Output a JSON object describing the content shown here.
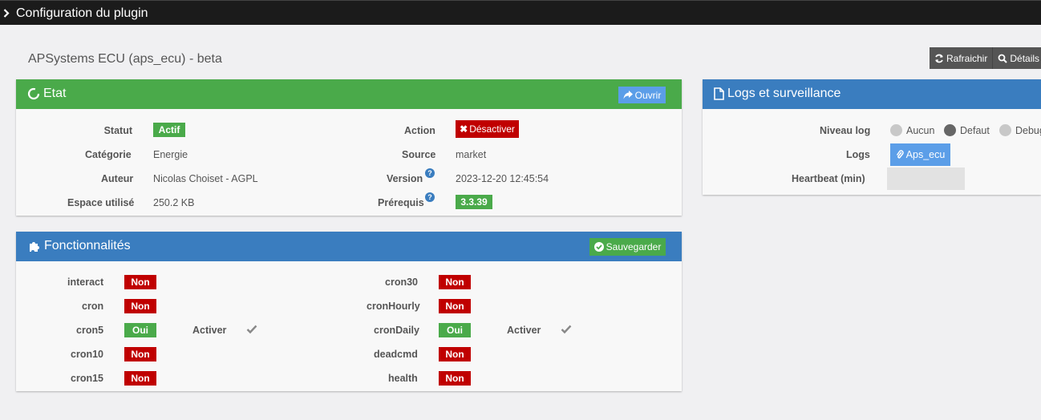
{
  "topbar": {
    "title": "Configuration du plugin"
  },
  "plugin": {
    "title": "APSystems ECU (aps_ecu) - beta"
  },
  "toolbar": {
    "refresh_label": "Rafraichir",
    "details_label": "Détails"
  },
  "etat": {
    "title": "Etat",
    "open_label": "Ouvrir",
    "statut_label": "Statut",
    "statut_value": "Actif",
    "categorie_label": "Catégorie",
    "categorie_value": "Energie",
    "auteur_label": "Auteur",
    "auteur_value": "Nicolas Choiset - AGPL",
    "espace_label": "Espace utilisé",
    "espace_value": "250.2 KB",
    "action_label": "Action",
    "action_value": "Désactiver",
    "source_label": "Source",
    "source_value": "market",
    "version_label": "Version",
    "version_value": "2023-12-20 12:45:54",
    "prerequis_label": "Prérequis",
    "prerequis_value": "3.3.39",
    "help_glyph": "?"
  },
  "features": {
    "title": "Fonctionnalités",
    "save_label": "Sauvegarder",
    "activer_label": "Activer",
    "left": [
      {
        "name": "interact",
        "value": "Non"
      },
      {
        "name": "cron",
        "value": "Non"
      },
      {
        "name": "cron5",
        "value": "Oui"
      },
      {
        "name": "cron10",
        "value": "Non"
      },
      {
        "name": "cron15",
        "value": "Non"
      }
    ],
    "right": [
      {
        "name": "cron30",
        "value": "Non"
      },
      {
        "name": "cronHourly",
        "value": "Non"
      },
      {
        "name": "cronDaily",
        "value": "Oui"
      },
      {
        "name": "deadcmd",
        "value": "Non"
      },
      {
        "name": "health",
        "value": "Non"
      }
    ]
  },
  "logs": {
    "title": "Logs et surveillance",
    "niveau_label": "Niveau log",
    "opt_aucun": "Aucun",
    "opt_defaut": "Defaut",
    "opt_debug": "Debug",
    "selected": "Defaut",
    "logs_label": "Logs",
    "logs_button": "Aps_ecu",
    "heartbeat_label": "Heartbeat (min)"
  },
  "colors": {
    "green": "#4aaa4a",
    "blue": "#3a7dbf",
    "red": "#c00000",
    "topbar": "#1b1b1b"
  }
}
